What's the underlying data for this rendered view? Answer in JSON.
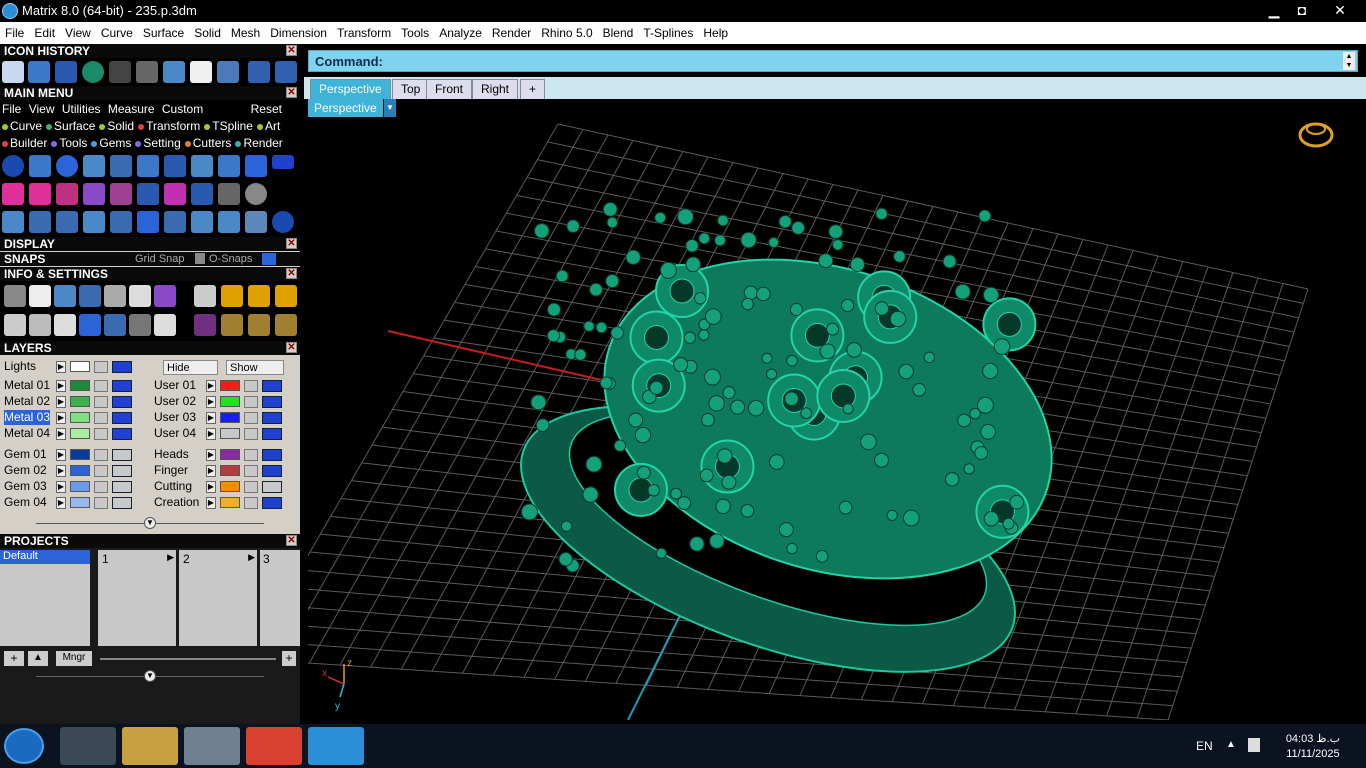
{
  "window": {
    "title": "Matrix 8.0 (64-bit) - 235.p.3dm",
    "minimize": "▁",
    "maximize": "◘",
    "close": "✕"
  },
  "menu": [
    "File",
    "Edit",
    "View",
    "Curve",
    "Surface",
    "Solid",
    "Mesh",
    "Dimension",
    "Transform",
    "Tools",
    "Analyze",
    "Render",
    "Rhino 5.0",
    "Blend",
    "T-Splines",
    "Help"
  ],
  "panels": {
    "icon_history": "ICON HISTORY",
    "main_menu": "MAIN MENU",
    "display": "DISPLAY",
    "snaps": "SNAPS",
    "info_settings": "INFO & SETTINGS",
    "layers": "LAYERS",
    "projects": "PROJECTS"
  },
  "main_menu_row1": [
    "File",
    "View",
    "Utilities",
    "Measure",
    "Custom"
  ],
  "main_menu_reset": "Reset",
  "main_menu_row2": [
    {
      "label": "Curve",
      "color": "#9acd32"
    },
    {
      "label": "Surface",
      "color": "#3cb371"
    },
    {
      "label": "Solid",
      "color": "#9acd32"
    },
    {
      "label": "Transform",
      "color": "#e04040"
    },
    {
      "label": "TSpline",
      "color": "#9acd32"
    },
    {
      "label": "Art",
      "color": "#9acd32"
    }
  ],
  "main_menu_row3": [
    {
      "label": "Builder",
      "color": "#e04040"
    },
    {
      "label": "Tools",
      "color": "#8a6ae0"
    },
    {
      "label": "Gems",
      "color": "#4aa0e0"
    },
    {
      "label": "Setting",
      "color": "#8a6ae0"
    },
    {
      "label": "Cutters",
      "color": "#e08030"
    },
    {
      "label": "Render",
      "color": "#3cb3a0"
    }
  ],
  "snaps": {
    "grid_snap": "Grid Snap",
    "o_snaps": "O-Snaps"
  },
  "layers": {
    "lights": "Lights",
    "hide": "Hide",
    "show": "Show",
    "left": [
      {
        "name": "Metal 01",
        "color": "#1e8a3c"
      },
      {
        "name": "Metal 02",
        "color": "#3cb04a"
      },
      {
        "name": "Metal 03",
        "color": "#7ee07e"
      },
      {
        "name": "Metal 04",
        "color": "#a8f0a0"
      },
      {
        "name": "Gem 01",
        "color": "#0a3a9a"
      },
      {
        "name": "Gem 02",
        "color": "#2a64d8"
      },
      {
        "name": "Gem 03",
        "color": "#6a9ae8"
      },
      {
        "name": "Gem 04",
        "color": "#9ab8f0"
      }
    ],
    "right": [
      {
        "name": "User 01",
        "color": "#ff1a1a"
      },
      {
        "name": "User 02",
        "color": "#22e022"
      },
      {
        "name": "User 03",
        "color": "#1a1aff"
      },
      {
        "name": "User 04",
        "color": "#c8c8c8"
      },
      {
        "name": "Heads",
        "color": "#8a2aa0"
      },
      {
        "name": "Finger",
        "color": "#b83a3a"
      },
      {
        "name": "Cutting",
        "color": "#ff8a00"
      },
      {
        "name": "Creation",
        "color": "#f0b020"
      }
    ]
  },
  "projects": {
    "default": "Default",
    "slots": [
      "1",
      "2",
      "3"
    ],
    "mngr": "Mngr"
  },
  "command": {
    "label": "Command:",
    "value": ""
  },
  "view_tabs": [
    "Perspective",
    "Top",
    "Front",
    "Right"
  ],
  "view_add": "+",
  "viewport_label": "Perspective",
  "axis": {
    "x": "x",
    "y": "y",
    "z": "z"
  },
  "taskbar": {
    "lang": "EN",
    "time": "04:03 ب.ظ",
    "date": "11/11/2025"
  }
}
